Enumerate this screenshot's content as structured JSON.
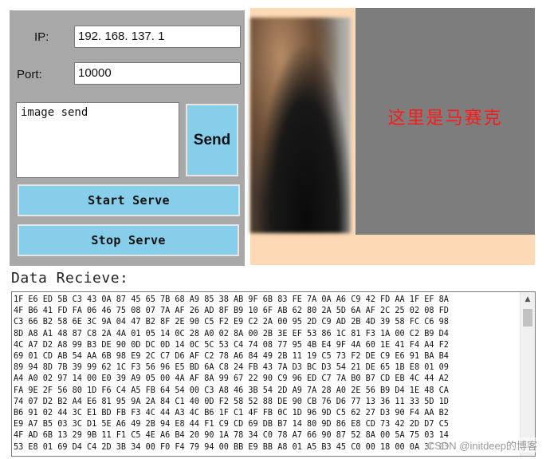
{
  "form": {
    "ip_label": "IP:",
    "ip_value": "192. 168. 137. 1",
    "port_label": "Port:",
    "port_value": "10000",
    "message_value": "image send",
    "send_label": "Send",
    "start_label": "Start Serve",
    "stop_label": "Stop Serve"
  },
  "video": {
    "mosaic_text": "这里是马赛克"
  },
  "receive": {
    "title": "Data Recieve:",
    "lines": [
      "1F E6 ED 5B C3 43 0A 87 45 65 7B 68 A9 85 38 AB 9F 6B 83 FE 7A 0A A6 C9 42 FD AA 1F EF 8A",
      "4F B6 41 FD FA 06 46 75 08 07 7A AF 26 AD 8F B9 10 6F AB 62 80 2A 5D 6A AF 2C 25 02 08 FD",
      "C3 66 B2 58 6E 3C 9A 04 47 B2 8F 2E 90 C5 F2 E9 C2 2A 00 95 2D C9 AD 2B 4D 39 58 FC C6 98",
      "8D A8 A1 48 87 C8 2A 4A 01 05 14 0C 28 A0 02 8A 00 2B 3E EF 53 86 1C 81 F3 1A 00 C2 B9 D4",
      "4C A7 D2 A8 99 B3 DE 90 0D DC 0D 14 0C 5C 53 C4 74 08 77 95 4B E4 9F 4A 60 1E 41 F4 A4 F2",
      "69 01 CD AB 54 AA 6B 98 E9 2C C7 D6 AF C2 78 A6 84 49 2B 11 19 C5 73 F2 DE C9 E6 91 BA B4",
      "89 94 8D 7B 39 99 62 1C F3 56 96 E5 BD 6A C8 24 FB 43 7A D3 BC D3 54 21 DE 65 1B E8 01 09",
      "A4 A0 02 97 14 00 E0 39 A9 05 00 4A AF 8A 99 67 22 90 C9 96 ED C7 7A B0 B7 CD EB 4C 44 A2",
      "FA 9E 2F 56 80 1D F6 C4 A5 FB 64 54 00 C3 A8 46 3B 54 2D A9 7A 28 A0 2E 56 B9 D4 1E 48 CA",
      "74 07 D2 B2 A4 E6 81 95 9A 2A 84 C1 40 0D F2 58 52 88 DE 90 CB 76 D6 77 13 36 11 33 5D 1D",
      "B6 91 02 44 3C E1 BD FB F3 4C 44 A3 4C B6 1F C1 4F FB 0C 1D 96 9D C5 62 27 D3 90 F4 AA B2",
      "E9 A7 B5 03 3C D1 5E A6 49 2B 94 E8 44 F1 C9 CD 69 DB B7 14 80 9D 86 E8 CD 73 42 2D D7 C5",
      "4F AD 6B 13 29 9B 11 F1 C5 4E A6 B4 20 90 1A 78 34 C0 78 A7 66 90 87 52 8A 00 5A 75 03 14",
      "53 E8 01 69 D4 C4 2D 3B 34 00 F0 F4 79 94 00 BB E9 BB A8 01 A5 B3 45 C0 00 18 00 0A 3C 03"
    ]
  },
  "watermark": "CSDN @initdeep的博客"
}
